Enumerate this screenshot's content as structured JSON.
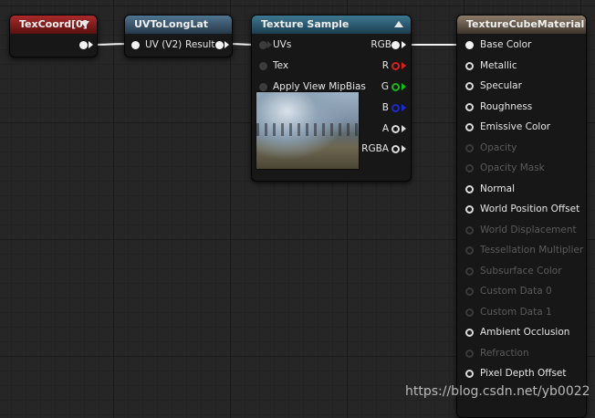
{
  "nodes": {
    "texcoord": {
      "title": "TexCoord[0]"
    },
    "uvtolonglat": {
      "title": "UVToLongLat",
      "input_label": "UV (V2)",
      "output_label": "Result"
    },
    "texture_sample": {
      "title": "Texture Sample",
      "inputs": [
        "UVs",
        "Tex",
        "Apply View MipBias"
      ],
      "outputs": [
        "RGB",
        "R",
        "G",
        "B",
        "A",
        "RGBA"
      ],
      "output_colors": {
        "R": "#d42020",
        "G": "#18b818",
        "B": "#1c2ad0"
      }
    },
    "material": {
      "title": "TextureCubeMaterial",
      "pins": [
        {
          "label": "Base Color",
          "state": "connected"
        },
        {
          "label": "Metallic",
          "state": "active"
        },
        {
          "label": "Specular",
          "state": "active"
        },
        {
          "label": "Roughness",
          "state": "active"
        },
        {
          "label": "Emissive Color",
          "state": "active"
        },
        {
          "label": "Opacity",
          "state": "disabled"
        },
        {
          "label": "Opacity Mask",
          "state": "disabled"
        },
        {
          "label": "Normal",
          "state": "active"
        },
        {
          "label": "World Position Offset",
          "state": "active"
        },
        {
          "label": "World Displacement",
          "state": "disabled"
        },
        {
          "label": "Tessellation Multiplier",
          "state": "disabled"
        },
        {
          "label": "Subsurface Color",
          "state": "disabled"
        },
        {
          "label": "Custom Data 0",
          "state": "disabled"
        },
        {
          "label": "Custom Data 1",
          "state": "disabled"
        },
        {
          "label": "Ambient Occlusion",
          "state": "active"
        },
        {
          "label": "Refraction",
          "state": "disabled"
        },
        {
          "label": "Pixel Depth Offset",
          "state": "active"
        }
      ]
    }
  },
  "watermark": "https://blog.csdn.net/yb0022"
}
